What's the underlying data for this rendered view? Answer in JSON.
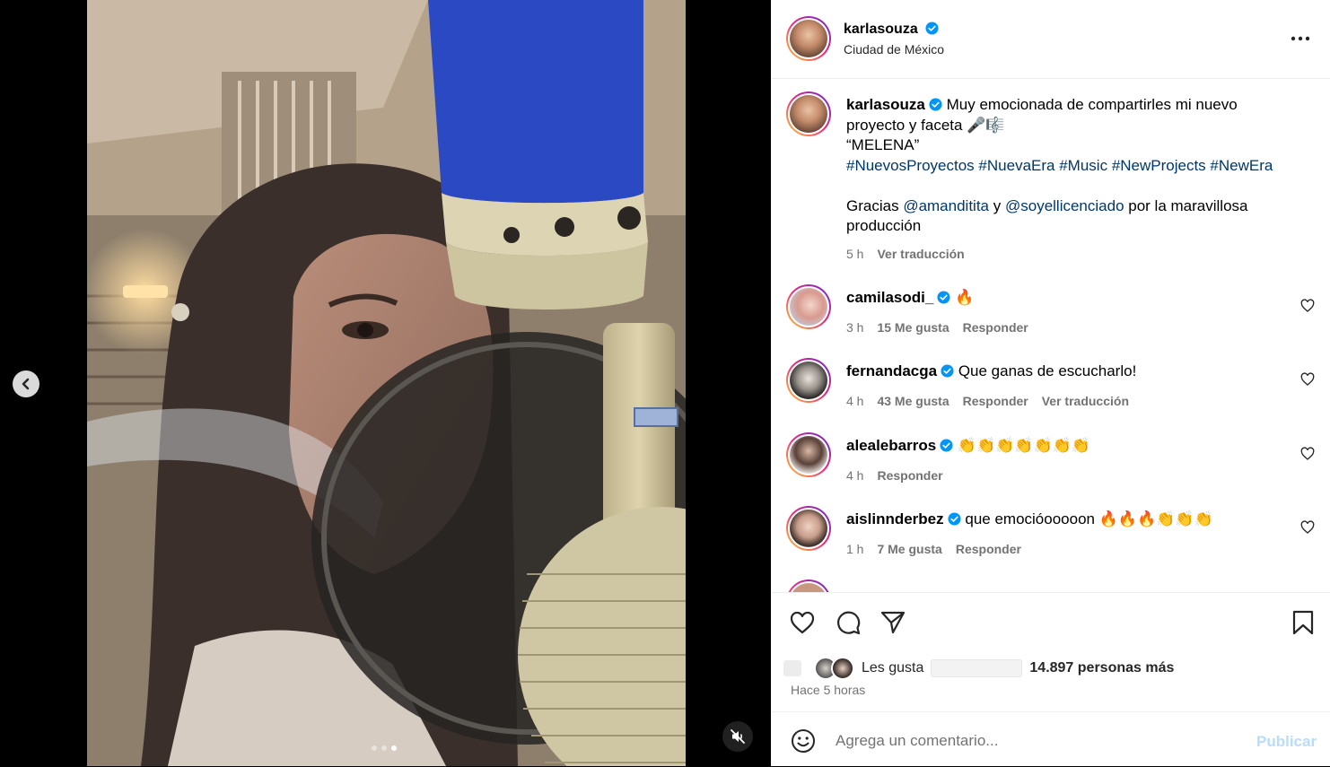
{
  "post": {
    "author": "karlasouza",
    "location": "Ciudad de México"
  },
  "caption": {
    "username": "karlasouza",
    "text_1": "Muy emocionada de compartirles mi nuevo proyecto y faceta",
    "emoji": "🎤🎼",
    "title": "“MELENA”",
    "hashtags": [
      "#NuevosProyectos",
      "#NuevaEra",
      "#Music",
      "#NewProjects",
      "#NewEra"
    ],
    "thanks_pre": "Gracias",
    "mention_1": "@amanditita",
    "thanks_mid": "y",
    "mention_2": "@soyellicenciado",
    "thanks_post": "por la maravillosa producción",
    "time": "5 h",
    "translate": "Ver traducción"
  },
  "comments": [
    {
      "username": "camilasodi_",
      "text": "🔥",
      "time": "3 h",
      "likes": "15 Me gusta",
      "reply": "Responder",
      "translate": ""
    },
    {
      "username": "fernandacga",
      "text": "Que ganas de escucharlo!",
      "time": "4 h",
      "likes": "43 Me gusta",
      "reply": "Responder",
      "translate": "Ver traducción"
    },
    {
      "username": "alealebarros",
      "text": "👏👏👏👏👏👏👏",
      "time": "4 h",
      "likes": "",
      "reply": "Responder",
      "translate": ""
    },
    {
      "username": "aislinnderbez",
      "text": "que emocióooooon 🔥🔥🔥👏👏👏",
      "time": "1 h",
      "likes": "7 Me gusta",
      "reply": "Responder",
      "translate": ""
    }
  ],
  "likes": {
    "prefix": "Les gusta",
    "count": "14.897 personas más"
  },
  "time_ago": "Hace 5 horas",
  "composer": {
    "placeholder": "Agrega un comentario...",
    "publish": "Publicar"
  },
  "icons": {
    "verified_color": "#0095f6",
    "link_color": "#00376b"
  },
  "carousel": {
    "count": 3,
    "active": 3
  }
}
